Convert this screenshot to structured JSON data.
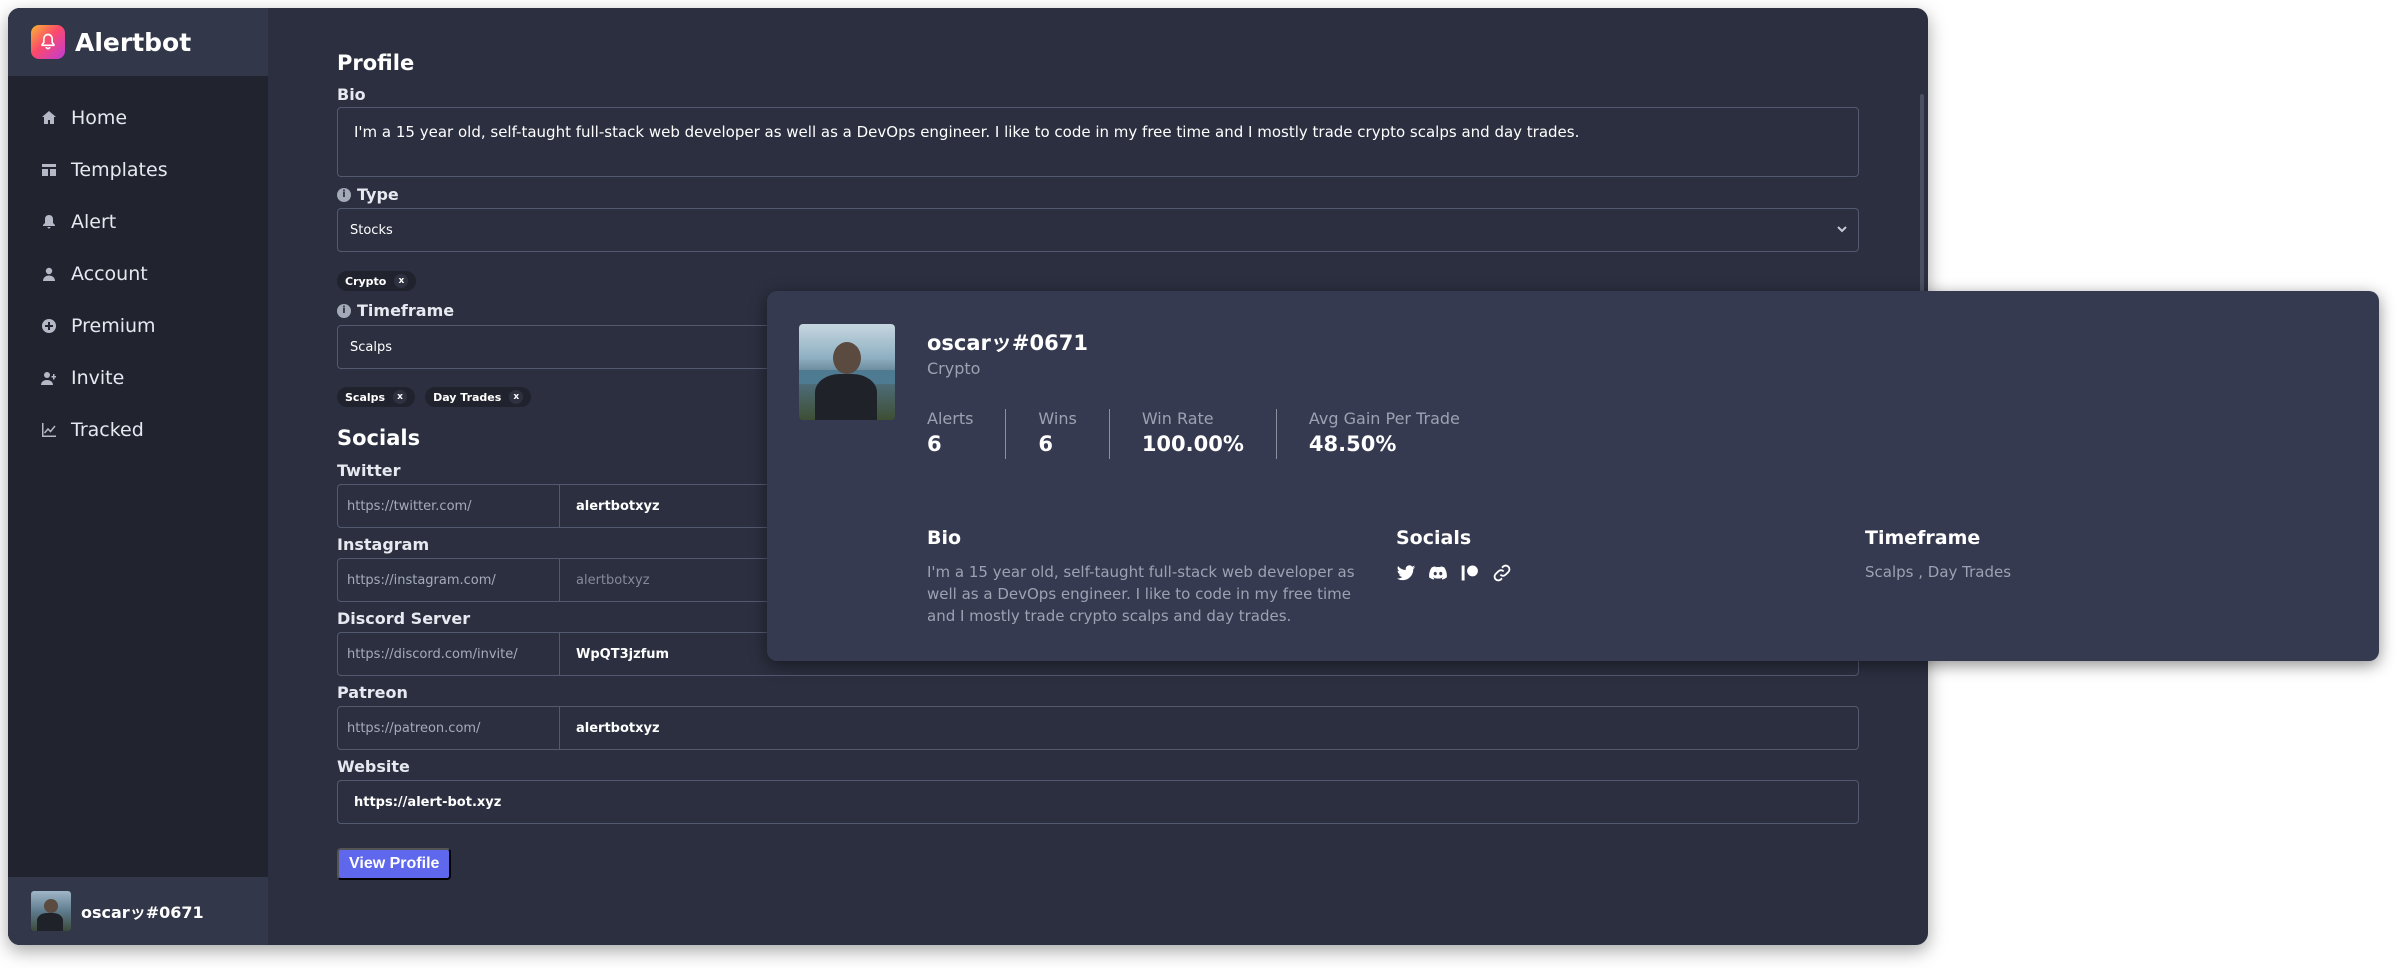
{
  "app": {
    "name": "Alertbot"
  },
  "sidebar": {
    "items": [
      {
        "label": "Home",
        "icon": "home-icon"
      },
      {
        "label": "Templates",
        "icon": "templates-icon"
      },
      {
        "label": "Alert",
        "icon": "bell-icon"
      },
      {
        "label": "Account",
        "icon": "user-icon"
      },
      {
        "label": "Premium",
        "icon": "plus-circle-icon"
      },
      {
        "label": "Invite",
        "icon": "user-add-icon"
      },
      {
        "label": "Tracked",
        "icon": "chart-line-icon"
      }
    ],
    "user": {
      "name": "oscarッ#0671"
    }
  },
  "profile_form": {
    "title": "Profile",
    "bio": {
      "label": "Bio",
      "value": "I'm a 15 year old, self-taught full-stack web developer as well as a DevOps engineer. I like to code in my free time and I mostly trade crypto scalps and day trades."
    },
    "type": {
      "label": "Type",
      "selected": "Stocks",
      "tags": [
        "Crypto"
      ]
    },
    "timeframe": {
      "label": "Timeframe",
      "selected": "Scalps",
      "tags": [
        "Scalps",
        "Day Trades"
      ]
    },
    "tag_remove": "x"
  },
  "socials_form": {
    "title": "Socials",
    "twitter": {
      "label": "Twitter",
      "prefix": "https://twitter.com/",
      "value": "alertbotxyz"
    },
    "instagram": {
      "label": "Instagram",
      "prefix": "https://instagram.com/",
      "placeholder": "alertbotxyz"
    },
    "discord": {
      "label": "Discord Server",
      "prefix": "https://discord.com/invite/",
      "value": "WpQT3jzfum"
    },
    "patreon": {
      "label": "Patreon",
      "prefix": "https://patreon.com/",
      "value": "alertbotxyz"
    },
    "website": {
      "label": "Website",
      "value": "https://alert-bot.xyz"
    }
  },
  "view_profile_button": "View Profile",
  "profile_card": {
    "name": "oscarッ#0671",
    "type": "Crypto",
    "stats": [
      {
        "label": "Alerts",
        "value": "6"
      },
      {
        "label": "Wins",
        "value": "6"
      },
      {
        "label": "Win Rate",
        "value": "100.00%"
      },
      {
        "label": "Avg Gain Per Trade",
        "value": "48.50%"
      }
    ],
    "bio": {
      "title": "Bio",
      "text": "I'm a 15 year old, self-taught full-stack web developer as well as a DevOps engineer. I like to code in my free time and I mostly trade crypto scalps and day trades."
    },
    "socials": {
      "title": "Socials",
      "icons": [
        "twitter-icon",
        "discord-icon",
        "patreon-icon",
        "link-icon"
      ]
    },
    "timeframe": {
      "title": "Timeframe",
      "text": "Scalps , Day Trades"
    }
  },
  "colors": {
    "window_bg": "#2b2f3f",
    "sidebar_bg": "#21242f",
    "card_bg": "#353a50",
    "accent": "#5f67ec"
  }
}
